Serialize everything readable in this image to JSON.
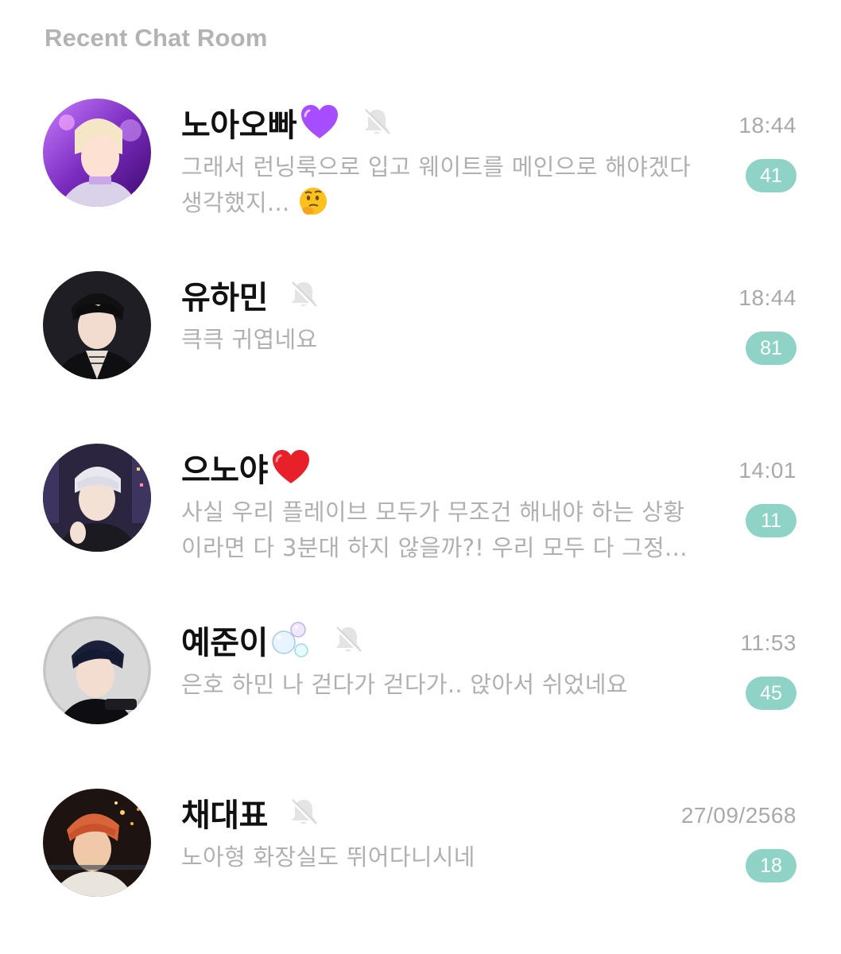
{
  "header": {
    "title": "Recent Chat Room"
  },
  "colors": {
    "badge": "#8ed3c6",
    "preview_text": "#b0b0b0",
    "time_text": "#a9a9a9",
    "title_text": "#b3b3b3"
  },
  "chats": [
    {
      "name": "노아오빠",
      "name_emoji": "purple-heart-icon",
      "muted": true,
      "preview": "그래서 런닝룩으로 입고 웨이트를 메인으로 해야겠다 생각했지...",
      "preview_emoji": "thinking-face-icon",
      "time": "18:44",
      "unread": "41"
    },
    {
      "name": "유하민",
      "name_emoji": "",
      "muted": true,
      "preview": "큭큭 귀엽네요",
      "preview_emoji": "",
      "time": "18:44",
      "unread": "81"
    },
    {
      "name": "으노야",
      "name_emoji": "red-heart-icon",
      "muted": false,
      "preview": "사실 우리 플레이브 모두가 무조건 해내야 하는 상황이라면 다 3분대 하지 않을까?! 우리 모두 다 그정...",
      "preview_emoji": "",
      "time": "14:01",
      "unread": "11"
    },
    {
      "name": "예준이",
      "name_emoji": "bubbles-icon",
      "muted": true,
      "preview": "은호 하민 나 걷다가 걷다가.. 앉아서 쉬었네요",
      "preview_emoji": "",
      "time": "11:53",
      "unread": "45"
    },
    {
      "name": "채대표",
      "name_emoji": "",
      "muted": true,
      "preview": "노아형 화장실도 뛰어다니시네",
      "preview_emoji": "",
      "time": "27/09/2568",
      "unread": "18"
    }
  ]
}
